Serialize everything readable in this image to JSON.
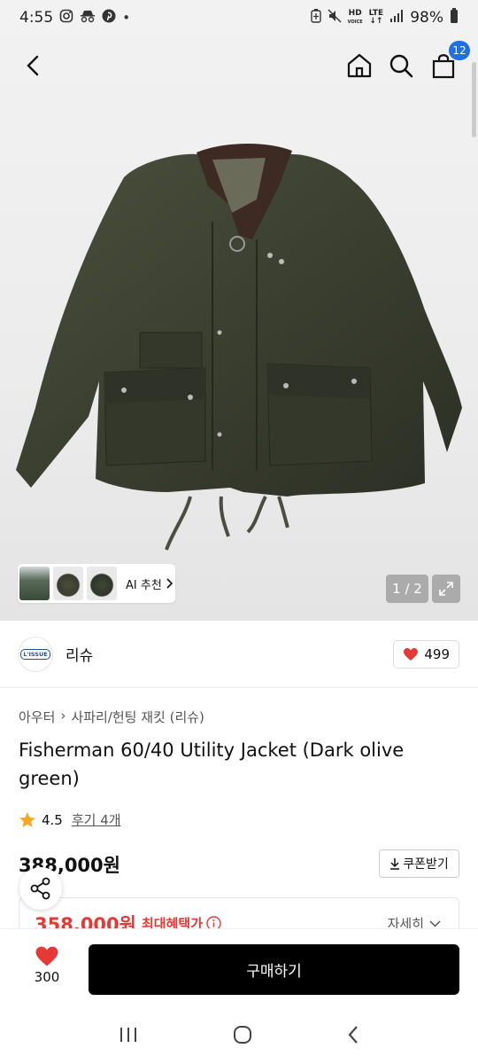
{
  "status_bar": {
    "time": "4:55",
    "battery": "98%",
    "hd_label": "HD",
    "voice_label": "VOICE",
    "lte_label": "LTE"
  },
  "header": {
    "cart_count": "12"
  },
  "gallery": {
    "ai_recommend": "AI 추천",
    "pager": "1 / 2"
  },
  "brand": {
    "logo_text": "L'ISSUE",
    "name": "리슈",
    "likes": "499"
  },
  "breadcrumb": {
    "category": "아우터",
    "subcategory": "사파리/헌팅 재킷 (리슈)"
  },
  "product": {
    "title": "Fisherman 60/40 Utility Jacket (Dark olive green)",
    "rating": "4.5",
    "reviews": "후기 4개",
    "original_price": "388,000원",
    "sale_price": "358,000원",
    "max_benefit_label": "최대혜택가",
    "detail_label": "자세히",
    "coupon_label": "쿠폰받기"
  },
  "bottom_bar": {
    "wish_count": "300",
    "buy_label": "구매하기"
  },
  "colors": {
    "accent_red": "#e53935",
    "badge_blue": "#1f6fe5",
    "jacket_olive": "#3b3f30"
  }
}
